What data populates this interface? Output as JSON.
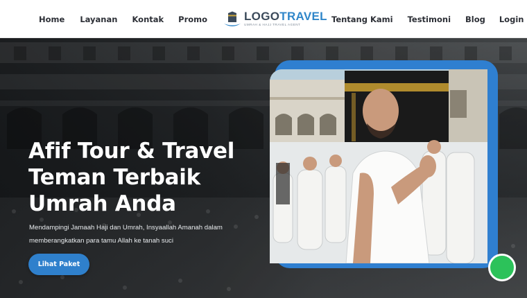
{
  "nav": {
    "left": [
      "Home",
      "Layanan",
      "Kontak",
      "Promo"
    ],
    "right": [
      "Tentang Kami",
      "Testimoni",
      "Blog",
      "Login"
    ]
  },
  "logo": {
    "title_part1": "LOGO",
    "title_part2": "TRAVEL",
    "tagline": "UMRAH & HAJJ TRAVEL AGENT",
    "icon": "kaaba-logo-icon"
  },
  "hero": {
    "title_line1": "Afif Tour & Travel",
    "title_line2": "Teman Terbaik",
    "title_line3": "Umrah Anda",
    "description": "Mendampingi Jamaah Haji dan Umrah, Insyaallah Amanah dalam memberangkatkan para tamu Allah ke tanah suci",
    "cta_label": "Lihat Paket"
  },
  "colors": {
    "accent": "#2f80cc",
    "nav_text": "#2c2f36",
    "chat": "#2cc25a"
  },
  "icons": {
    "chat": "whatsapp-chat-icon"
  }
}
